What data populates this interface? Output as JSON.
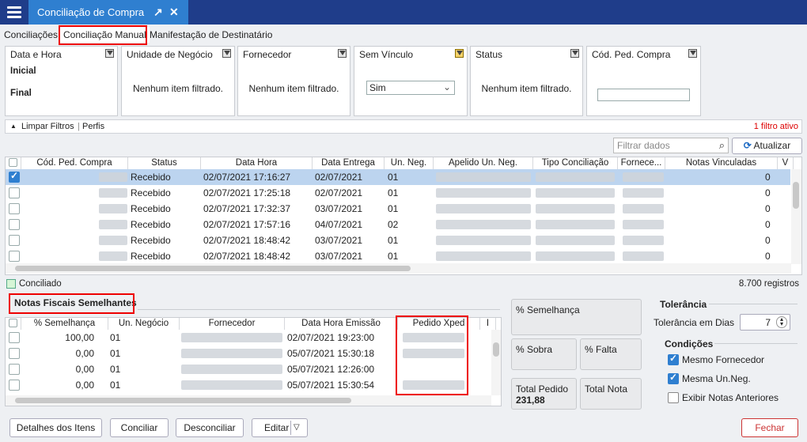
{
  "window": {
    "title": "Conciliação de Compra"
  },
  "tabs": [
    "Conciliações",
    "Conciliação Manual",
    "Manifestação de Destinatário"
  ],
  "filters": {
    "data_hora": {
      "label": "Data e Hora",
      "inicial": "Inicial",
      "final": "Final"
    },
    "unidade": {
      "label": "Unidade de Negócio",
      "empty": "Nenhum item filtrado."
    },
    "fornecedor": {
      "label": "Fornecedor",
      "empty": "Nenhum item filtrado."
    },
    "sem_vinculo": {
      "label": "Sem Vínculo",
      "value": "Sim"
    },
    "status": {
      "label": "Status",
      "empty": "Nenhum item filtrado."
    },
    "cod_ped": {
      "label": "Cód. Ped. Compra",
      "value": ""
    }
  },
  "toolbar": {
    "limpar": "Limpar Filtros",
    "perfis": "Perfis",
    "active_filters": "1 filtro ativo",
    "search_placeholder": "Filtrar dados",
    "atualizar": "Atualizar"
  },
  "grid": {
    "columns": [
      "Cód. Ped. Compra",
      "Status",
      "Data Hora",
      "Data Entrega",
      "Un. Neg.",
      "Apelido Un. Neg.",
      "Tipo Conciliação",
      "Fornece...",
      "Notas Vinculadas",
      "V"
    ],
    "rows": [
      {
        "checked": true,
        "status": "Recebido",
        "data_hora": "02/07/2021 17:16:27",
        "entrega": "02/07/2021",
        "un": "01",
        "notas": "0"
      },
      {
        "checked": false,
        "status": "Recebido",
        "data_hora": "02/07/2021 17:25:18",
        "entrega": "02/07/2021",
        "un": "01",
        "notas": "0"
      },
      {
        "checked": false,
        "status": "Recebido",
        "data_hora": "02/07/2021 17:32:37",
        "entrega": "03/07/2021",
        "un": "01",
        "notas": "0"
      },
      {
        "checked": false,
        "status": "Recebido",
        "data_hora": "02/07/2021 17:57:16",
        "entrega": "04/07/2021",
        "un": "02",
        "notas": "0"
      },
      {
        "checked": false,
        "status": "Recebido",
        "data_hora": "02/07/2021 18:48:42",
        "entrega": "03/07/2021",
        "un": "01",
        "notas": "0"
      },
      {
        "checked": false,
        "status": "Recebido",
        "data_hora": "02/07/2021 18:48:42",
        "entrega": "03/07/2021",
        "un": "01",
        "notas": "0"
      }
    ],
    "legend": "Conciliado",
    "count": "8.700 registros"
  },
  "notas": {
    "title": "Notas Fiscais Semelhantes",
    "columns": [
      "% Semelhança",
      "Un. Negócio",
      "Fornecedor",
      "Data Hora Emissão",
      "Pedido Xped",
      "I"
    ],
    "rows": [
      {
        "pct": "100,00",
        "un": "01",
        "data": "02/07/2021 19:23:00"
      },
      {
        "pct": "0,00",
        "un": "01",
        "data": "05/07/2021 15:30:18"
      },
      {
        "pct": "0,00",
        "un": "01",
        "data": "05/07/2021 12:26:00"
      },
      {
        "pct": "0,00",
        "un": "01",
        "data": "05/07/2021 15:30:54"
      }
    ]
  },
  "cards": {
    "semelhanca": "% Semelhança",
    "sobra": "% Sobra",
    "falta": "% Falta",
    "total_pedido": "Total Pedido",
    "total_pedido_value": "231,88",
    "total_nota": "Total Nota"
  },
  "tolerancia": {
    "title": "Tolerância",
    "dias_label": "Tolerância em Dias",
    "dias_value": "7"
  },
  "condicoes": {
    "title": "Condições",
    "items": [
      {
        "label": "Mesmo Fornecedor",
        "checked": true
      },
      {
        "label": "Mesma Un.Neg.",
        "checked": true
      },
      {
        "label": "Exibir Notas Anteriores",
        "checked": false
      }
    ]
  },
  "buttons": {
    "detalhes": "Detalhes dos Itens",
    "conciliar": "Conciliar",
    "desconciliar": "Desconciliar",
    "editar": "Editar",
    "fechar": "Fechar"
  }
}
